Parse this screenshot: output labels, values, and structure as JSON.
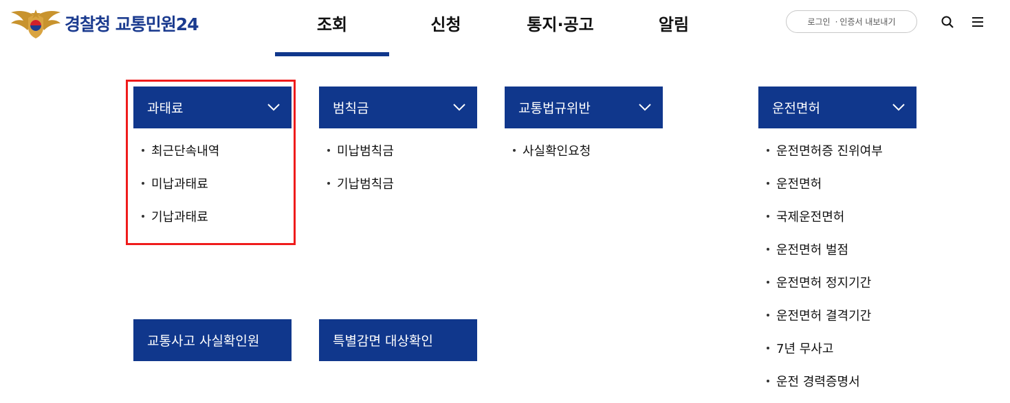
{
  "header": {
    "logo_text": "경찰청 교통민원24",
    "nav": [
      "조회",
      "신청",
      "통지·공고",
      "알림"
    ],
    "active_nav": "조회",
    "login_label": "로그인",
    "cert_label": "인증서 내보내기",
    "icons": [
      "police-emblem-icon",
      "search-icon",
      "menu-icon"
    ]
  },
  "menus": [
    {
      "title": "과태료",
      "items": [
        "최근단속내역",
        "미납과태료",
        "기납과태료"
      ]
    },
    {
      "title": "범칙금",
      "items": [
        "미납범칙금",
        "기납범칙금"
      ]
    },
    {
      "title": "교통법규위반",
      "items": [
        "사실확인요청"
      ]
    },
    {
      "title": "운전면허",
      "items": [
        "운전면허증 진위여부",
        "운전면허",
        "국제운전면허",
        "운전면허 벌점",
        "운전면허 정지기간",
        "운전면허 결격기간",
        "7년 무사고",
        "운전 경력증명서"
      ]
    }
  ],
  "solo_buttons": [
    "교통사고 사실확인원",
    "특별감면 대상확인"
  ],
  "colors": {
    "brand": "#10378c",
    "highlight": "#ef1b1b"
  }
}
